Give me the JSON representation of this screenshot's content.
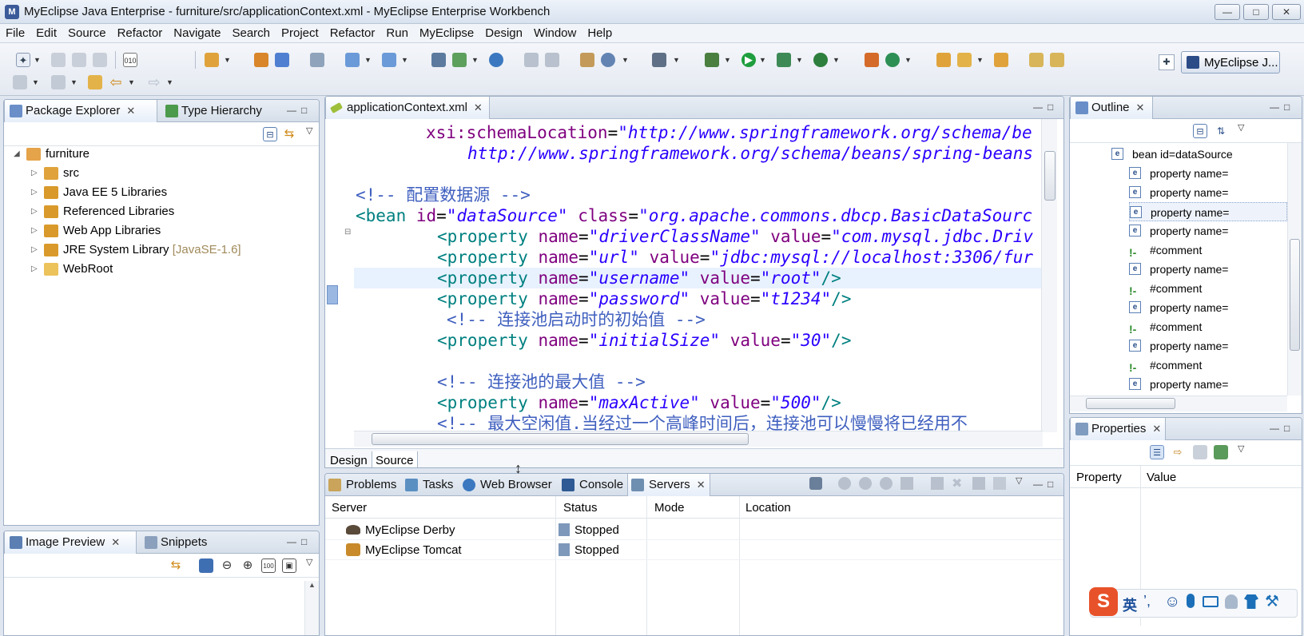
{
  "window": {
    "title": "MyEclipse Java Enterprise - furniture/src/applicationContext.xml - MyEclipse Enterprise Workbench",
    "icon": "myeclipse-logo-icon",
    "controls": [
      "minimize-icon",
      "maximize-icon",
      "close-icon"
    ]
  },
  "menu": [
    "File",
    "Edit",
    "Source",
    "Refactor",
    "Navigate",
    "Search",
    "Project",
    "Refactor",
    "Run",
    "MyEclipse",
    "Design",
    "Window",
    "Help"
  ],
  "perspective": {
    "label": "MyEclipse J..."
  },
  "package_explorer": {
    "tabs": [
      "Package Explorer",
      "Type Hierarchy"
    ],
    "tree": [
      {
        "label": "furniture",
        "icon": "project-icon"
      },
      {
        "label": "src",
        "icon": "source-folder-icon"
      },
      {
        "label": "Java EE 5 Libraries",
        "icon": "library-icon"
      },
      {
        "label": "Referenced Libraries",
        "icon": "library-icon"
      },
      {
        "label": "Web App Libraries",
        "icon": "library-icon"
      },
      {
        "label": "JRE System Library",
        "suffix": "[JavaSE-1.6]",
        "icon": "library-icon"
      },
      {
        "label": "WebRoot",
        "icon": "folder-icon"
      }
    ]
  },
  "image_preview": {
    "tabs": [
      "Image Preview",
      "Snippets"
    ]
  },
  "editor": {
    "tab": "applicationContext.xml",
    "code": {
      "l1": {
        "attr": "xsi:schemaLocation",
        "eq": "=",
        "val": "\"http://www.springframework.org/schema/be"
      },
      "l2": {
        "val": "http://www.springframework.org/schema/beans/spring-beans"
      },
      "l3": {
        "comment": "<!-- 配置数据源 -->"
      },
      "l4": {
        "open": "<bean",
        "a1": "id",
        "v1": "\"dataSource\"",
        "a2": "class",
        "v2": "\"org.apache.commons.dbcp.BasicDataSourc"
      },
      "l5": {
        "tag": "<property",
        "a1": "name",
        "v1": "\"driverClassName\"",
        "a2": "value",
        "v2": "\"com.mysql.jdbc.Driv"
      },
      "l6": {
        "tag": "<property",
        "a1": "name",
        "v1": "\"url\"",
        "a2": "value",
        "v2": "\"jdbc:mysql://localhost:3306/fur"
      },
      "l7": {
        "tag": "<property",
        "a1": "name",
        "v1": "\"username\"",
        "a2": "value",
        "v2": "\"root\"",
        "end": "/>"
      },
      "l8": {
        "tag": "<property",
        "a1": "name",
        "v1": "\"password\"",
        "a2": "value",
        "v2": "\"t1234\"",
        "end": "/>"
      },
      "l9": {
        "comment": "<!-- 连接池启动时的初始值 -->"
      },
      "l10": {
        "tag": "<property",
        "a1": "name",
        "v1": "\"initialSize\"",
        "a2": "value",
        "v2": "\"30\"",
        "end": "/>"
      },
      "l11": {
        "comment": "<!-- 连接池的最大值 -->"
      },
      "l12": {
        "tag": "<property",
        "a1": "name",
        "v1": "\"maxActive\"",
        "a2": "value",
        "v2": "\"500\"",
        "end": "/>"
      },
      "l13": {
        "comment": "<!-- 最大空闲值.当经过一个高峰时间后，连接池可以慢慢将已经用不"
      }
    },
    "bottom_tabs": [
      "Design",
      "Source"
    ]
  },
  "bottom_panel": {
    "tabs": [
      "Problems",
      "Tasks",
      "Web Browser",
      "Console",
      "Servers"
    ],
    "columns": [
      "Server",
      "Status",
      "Mode",
      "Location"
    ],
    "rows": [
      {
        "server": "MyEclipse Derby",
        "status": "Stopped",
        "icon": "derby-server-icon"
      },
      {
        "server": "MyEclipse Tomcat",
        "status": "Stopped",
        "icon": "tomcat-server-icon"
      }
    ]
  },
  "outline": {
    "tab": "Outline",
    "rows": [
      {
        "kind": "e",
        "label": "bean id=dataSource"
      },
      {
        "kind": "e",
        "label": "property name="
      },
      {
        "kind": "e",
        "label": "property name="
      },
      {
        "kind": "e",
        "label": "property name="
      },
      {
        "kind": "e",
        "label": "property name="
      },
      {
        "kind": "c",
        "label": "#comment"
      },
      {
        "kind": "e",
        "label": "property name="
      },
      {
        "kind": "c",
        "label": "#comment"
      },
      {
        "kind": "e",
        "label": "property name="
      },
      {
        "kind": "c",
        "label": "#comment"
      },
      {
        "kind": "e",
        "label": "property name="
      },
      {
        "kind": "c",
        "label": "#comment"
      },
      {
        "kind": "e",
        "label": "property name="
      }
    ]
  },
  "properties": {
    "tab": "Properties",
    "columns": [
      "Property",
      "Value"
    ]
  },
  "ime": {
    "label": "英"
  },
  "colors": {
    "accent": "#2a00ff",
    "attr": "#7f007f",
    "tag": "#008080",
    "comment": "#3f5fbf"
  }
}
